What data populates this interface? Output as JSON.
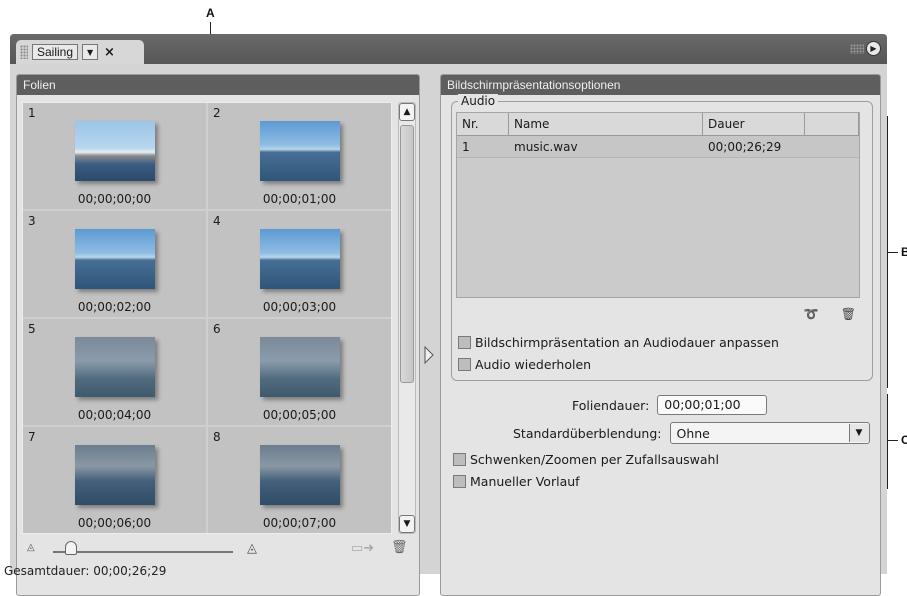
{
  "callouts": {
    "a": "A",
    "b": "B",
    "c": "C"
  },
  "tab": {
    "title": "Sailing",
    "menu_icon": "▼",
    "close_icon": "×"
  },
  "panel_menu_icon": "▶",
  "left_panel": {
    "title": "Folien",
    "slides": [
      {
        "num": "1",
        "time": "00;00;00;00",
        "image": "harbor"
      },
      {
        "num": "2",
        "time": "00;00;01;00",
        "image": "sea"
      },
      {
        "num": "3",
        "time": "00;00;02;00",
        "image": "sea"
      },
      {
        "num": "4",
        "time": "00;00;03;00",
        "image": "sea"
      },
      {
        "num": "5",
        "time": "00;00;04;00",
        "image": "sail"
      },
      {
        "num": "6",
        "time": "00;00;05;00",
        "image": "sail"
      },
      {
        "num": "7",
        "time": "00;00;06;00",
        "image": "race"
      },
      {
        "num": "8",
        "time": "00;00;07;00",
        "image": "race"
      }
    ],
    "scroll_up": "▲",
    "scroll_down": "▼"
  },
  "total_duration": "Gesamtdauer: 00;00;26;29",
  "right_panel": {
    "title": "Bildschirmpräsentationsoptionen",
    "audio": {
      "legend": "Audio",
      "columns": [
        "Nr.",
        "Name",
        "Dauer",
        ""
      ],
      "rows": [
        {
          "nr": "1",
          "name": "music.wav",
          "dauer": "00;00;26;29"
        }
      ],
      "fit_checkbox": "Bildschirmpräsentation an Audiodauer anpassen",
      "repeat_checkbox": "Audio wiederholen"
    },
    "slide_duration_label": "Foliendauer:",
    "slide_duration_value": "00;00;01;00",
    "transition_label": "Standardüberblendung:",
    "transition_value": "Ohne",
    "pan_zoom_checkbox": "Schwenken/Zoomen per Zufallsauswahl",
    "manual_checkbox": "Manueller Vorlauf"
  },
  "colors": {
    "panel_header": "#5e5e5e",
    "frame": "#4f4f4f",
    "body": "#d4d4d4"
  }
}
